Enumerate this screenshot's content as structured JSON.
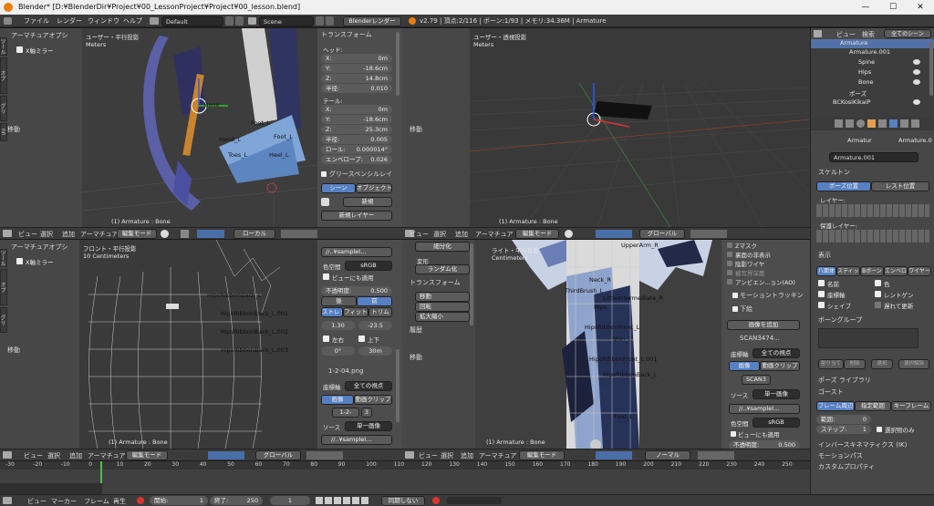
{
  "window": {
    "title": "Blender* [D:¥BlenderDir¥Project¥00_LessonProject¥Project¥00_lesson.blend]",
    "min": "—",
    "max": "☐",
    "close": "✕"
  },
  "topmenu": {
    "items": [
      "ファイル",
      "レンダー",
      "ウィンドウ",
      "ヘルプ"
    ],
    "layout": "Default",
    "scene": "Scene",
    "engine": "Blenderレンダー",
    "info": "v2.79 | 頂点:2/116 | ボーン:1/93 | メモリ:34.36M | Armature"
  },
  "tl": {
    "left": {
      "title": "アーマチュアオプシ",
      "xmirror": "X軸ミラー",
      "move": "移動"
    },
    "view": "ユーザー・平行投影",
    "units": "Meters",
    "status": "(1) Armature : Bone",
    "labels": [
      "Bone",
      "Hand_L",
      "Foot_L",
      "Foot_L",
      "Toes_L",
      "Heel_L"
    ],
    "props": {
      "transform": "トランスフォーム",
      "head": "ヘッド:",
      "x1": "X:",
      "x1v": "0m",
      "y1": "Y:",
      "y1v": "-18.6cm",
      "z1": "Z:",
      "z1v": "14.8cm",
      "r1": "半径:",
      "r1v": "0.010",
      "tail": "テール:",
      "x2": "X:",
      "x2v": "0m",
      "y2": "Y:",
      "y2v": "-18.6cm",
      "z2": "Z:",
      "z2v": "25.3cm",
      "r2": "半径:",
      "r2v": "0.005",
      "roll": "ロール:",
      "rollv": "0.000014°",
      "env": "エンベロープ:",
      "envv": "0.026",
      "grease": "グリースペンシルレイ",
      "scene": "シーン",
      "object": "オブジェクト",
      "new": "新規",
      "newlayer": "新規レイヤー"
    },
    "header": {
      "view": "ビュー",
      "select": "選択",
      "add": "追加",
      "arm": "アーマチュア",
      "mode": "編集モード",
      "orient": "ローカル"
    }
  },
  "tr": {
    "view": "ユーザー・透視投影",
    "units": "Meters",
    "status": "(1) Armature : Bone",
    "move": "移動",
    "header": {
      "view": "ビュー",
      "select": "選択",
      "add": "追加",
      "arm": "アーマチュア",
      "mode": "編集モード",
      "orient": "グローバル"
    }
  },
  "bl": {
    "left": {
      "title": "アーマチュアオプシ",
      "xmirror": "X軸ミラー",
      "move": "移動"
    },
    "view": "フロント・平行投影",
    "units": "10 Centimeters",
    "status": "(1) Armature : Bone",
    "labels": [
      "HipsRibbonBack_L.001",
      "HipsRibbonBack_L.002",
      "HipsRibbonBack_L.003",
      "HipsRibbonBack_L"
    ],
    "props": {
      "file": "//..¥sampleI...",
      "colorspace": "色空間",
      "srgb": "sRGB",
      "viewas": "ビューにも適用",
      "opacity": "不透明度:",
      "opacityv": "0.500",
      "back": "後",
      "front": "前",
      "stretch": "ストレッ",
      "fit": "フィット",
      "crop": "トリム",
      "sx": "1.30",
      "sy": "-23.5",
      "flipx": "左右",
      "flipy": "上下",
      "rot": "0°",
      "size": "30m",
      "img2": "1-2-04.png",
      "coordlbl": "座標軸",
      "coordv": "全ての視点",
      "image": "画像",
      "clip": "動画クリップ",
      "fname": "1-2-",
      "frame": "3",
      "source": "ソース",
      "sourcev": "単一画像",
      "file2": "//..¥sampleI..."
    },
    "header": {
      "view": "ビュー",
      "select": "選択",
      "add": "追加",
      "arm": "アーマチュア",
      "mode": "編集モード",
      "orient": "グローバル"
    }
  },
  "br": {
    "left": {
      "smooth": "細分化",
      "deform": "変形",
      "random": "ランダム化",
      "transform": "トランスフォーム",
      "move": "移動",
      "rotate": "回転",
      "scale": "拡大縮小",
      "history": "履歴"
    },
    "view": "ライト・平行投影",
    "units": "Centimeters",
    "status": "(1) Armature : Bone",
    "labels": [
      "UpperArm_R",
      "Neck_R",
      "Hips",
      "ThirdBrush_L",
      "HipsRibbonFront_L",
      "HipsRibbonFront_L.001",
      "LittleIntermediate_R",
      "Shin_L",
      "HipsRibbonBack_L",
      "Foot_L"
    ],
    "props": {
      "a": "Zマスク",
      "b": "裏面の非表示",
      "c": "陰影ワイヤ",
      "d": "被写界深度",
      "e": "アンビエン...ョン(AO)",
      "motion": "モーショントラッキン",
      "bg": "下絵",
      "addimg": "画像を追加",
      "scan": "SCAN3474...",
      "coordlbl": "座標軸",
      "coordv": "全ての視点",
      "image": "画像",
      "clip": "動画クリップ",
      "fname": "SCAN3",
      "source": "ソース",
      "sourcev": "単一画像",
      "file": "//..¥sampleI...",
      "colorspace": "色空間",
      "srgb": "sRGB",
      "viewas": "ビューにも適用",
      "opacity": "不透明度:",
      "opacityv": "0.500"
    },
    "header": {
      "view": "ビュー",
      "select": "選択",
      "add": "追加",
      "arm": "アーマチュア",
      "mode": "編集モード",
      "orient": "ノーマル"
    }
  },
  "outliner": {
    "view": "ビュー",
    "search": "検索",
    "scenes": "全てのシーン",
    "items": [
      "Armature",
      "Armature.001",
      "Spine",
      "Hips",
      "Bone",
      "ポーズ",
      "BCKosiKikaiP"
    ]
  },
  "properties": {
    "path1": "Armatur",
    "path2": "Armature.0",
    "name": "Armature.001",
    "skeleton": "スケルトン",
    "pose": "ポーズ位置",
    "rest": "レスト位置",
    "layers": "レイヤー:",
    "protected": "保護レイヤー:",
    "display": "表示",
    "tabs": [
      "八面体",
      "スティック",
      "Bボーン",
      "エンベロ",
      "ワイヤー"
    ],
    "names": "名前",
    "axes": "座標軸",
    "shape": "シェイプ",
    "colors": "色",
    "xray": "レントゲン",
    "delay": "遅れて更新",
    "bonegroups": "ボーングループ",
    "assign": "割り当て",
    "remove": "削除",
    "select": "選択",
    "deselect": "選択解除",
    "poselib": "ポーズ ライブラリ",
    "ghost": "ゴースト",
    "frameall": "フレーム周辺",
    "range": "指定範囲",
    "keyframe": "キーフレーム",
    "range_lbl": "範囲:",
    "range_v": "0",
    "step_lbl": "ステップ:",
    "step_v": "1",
    "selonly": "選択物のみ",
    "ik": "インバースキネマティクス (IK)",
    "motionpath": "モーションパス",
    "custom": "カスタムプロパティ"
  },
  "timeline": {
    "ticks": [
      "-30",
      "-20",
      "-10",
      "0",
      "10",
      "20",
      "30",
      "40",
      "50",
      "60",
      "70",
      "80",
      "90",
      "100",
      "110",
      "120",
      "130",
      "140",
      "150",
      "160",
      "170",
      "180",
      "190",
      "200",
      "210",
      "220",
      "230",
      "240",
      "250"
    ],
    "menu": [
      "ビュー",
      "マーカー",
      "フレーム",
      "再生"
    ],
    "start_lbl": "開始:",
    "start": "1",
    "end_lbl": "終了:",
    "end": "250",
    "current": "1",
    "sync": "同期しない"
  }
}
